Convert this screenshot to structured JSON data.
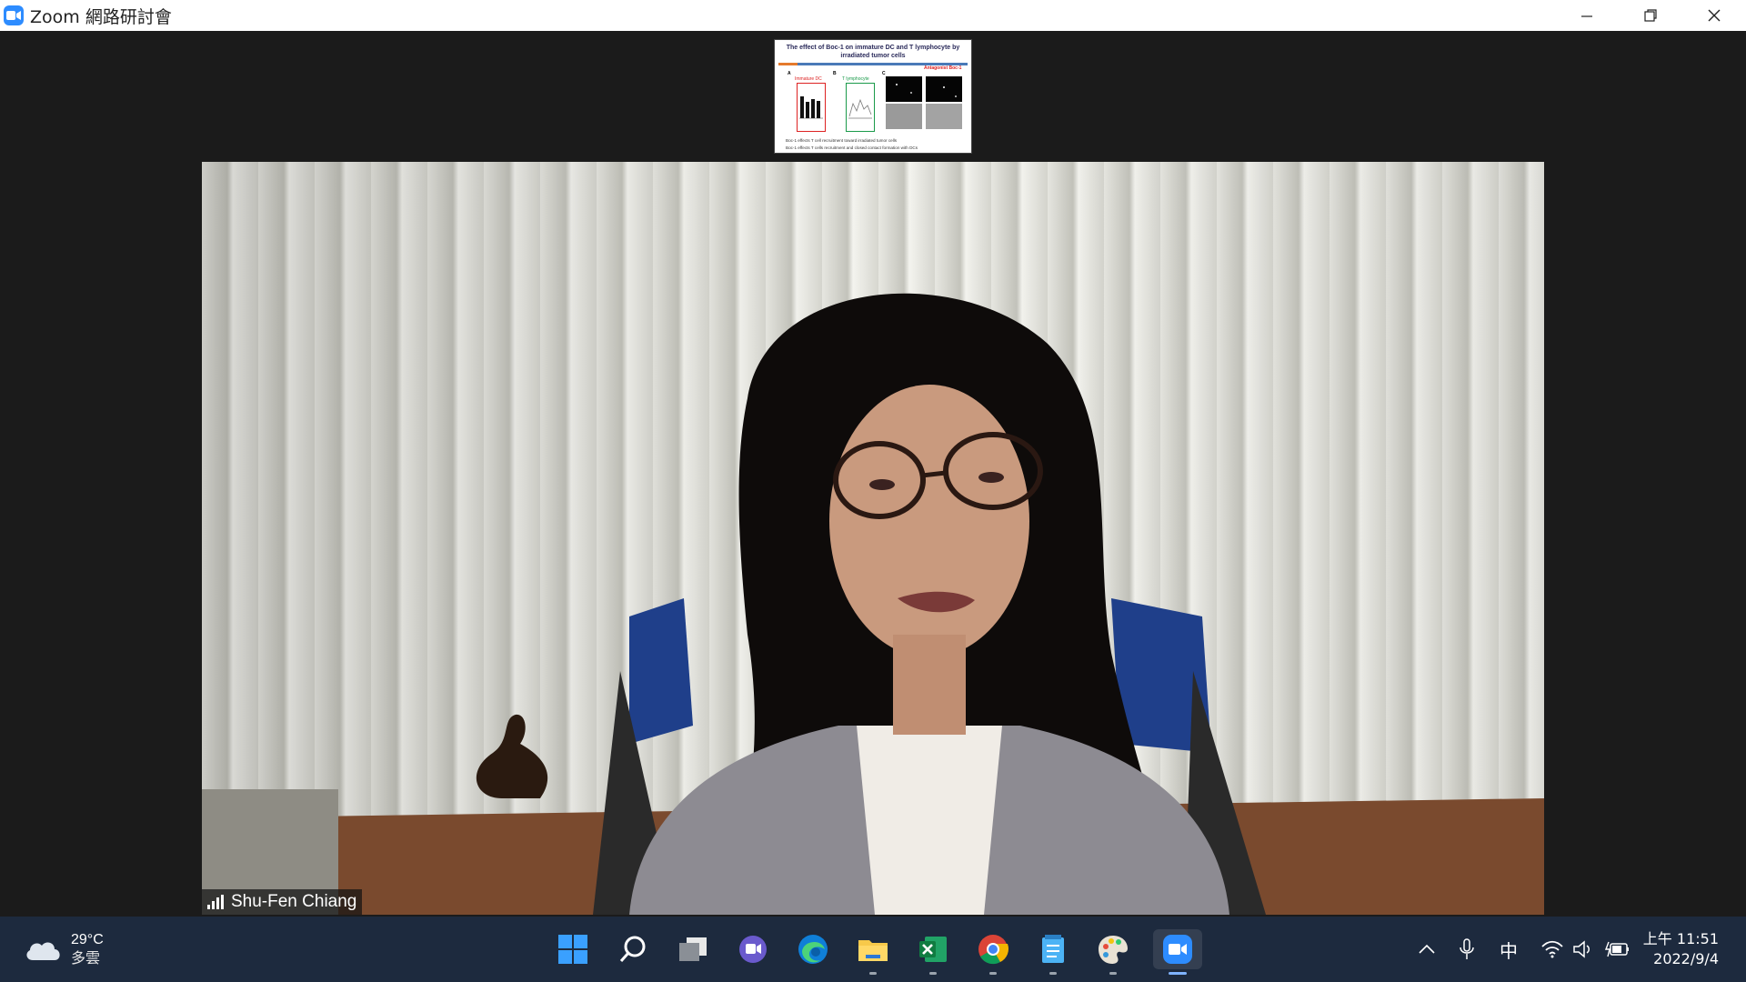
{
  "window": {
    "title": "Zoom 網路研討會"
  },
  "slide": {
    "title": "The effect of Boc-1 on immature DC and T lymphocyte by irradiated tumor cells",
    "panels": [
      "A",
      "B",
      "C"
    ],
    "label_a": "Immature DC",
    "label_b": "T lymphocyte",
    "label_c": "Antagonist Boc-1",
    "bullets": [
      "Boc-1 effects T cell recruitment toward irradiated tumor cells",
      "Boc-1 effects T cells recruitment and closed contact formation with DCs"
    ]
  },
  "participant": {
    "name": "Shu-Fen Chiang"
  },
  "taskbar": {
    "weather": {
      "temp": "29°C",
      "condition": "多雲"
    },
    "ime": "中",
    "time": "上午 11:51",
    "date": "2022/9/4",
    "apps": [
      "start-icon",
      "search-icon",
      "task-view-icon",
      "teams-chat-icon",
      "edge-icon",
      "file-explorer-icon",
      "excel-icon",
      "chrome-icon",
      "notepad-icon",
      "paint-icon",
      "zoom-icon"
    ]
  },
  "colors": {
    "taskbar": "#1d2a3e",
    "zoom_blue": "#2d8cff",
    "background": "#1b1b1b"
  }
}
